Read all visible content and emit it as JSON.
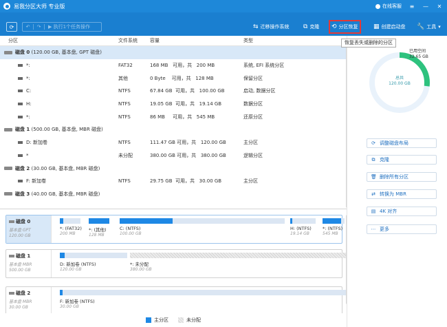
{
  "app": {
    "title": "易我分区大师 专业版",
    "online_service": "在线客服",
    "win_menu": "≡",
    "win_min": "—",
    "win_close": "✕"
  },
  "toolbar": {
    "refresh": "⟳",
    "undo": "↶",
    "redo": "↷",
    "pending_ops": "▶ 执行1个任务操作",
    "migrate_os": "迁移操作系统",
    "clone": "克隆",
    "partition_recovery": "分区恢复",
    "create_boot": "创建启动盘",
    "tools": "工具",
    "tooltip": "恢复丢失或删除的分区"
  },
  "table": {
    "headers": {
      "partition": "分区",
      "filesystem": "文件系统",
      "capacity": "容量",
      "type": "类型"
    },
    "rows": [
      {
        "kind": "disk",
        "name": "磁盘 0",
        "info": "(120.00 GB, 基本盘, GPT 磁盘)",
        "selected": true
      },
      {
        "kind": "part",
        "name": "*:",
        "fs": "FAT32",
        "cap": "168 MB   可用，共   200 MB",
        "type": "系统, EFI 系统分区"
      },
      {
        "kind": "part",
        "name": "*:",
        "fs": "其他",
        "cap": "0 Byte    可用，共   128 MB",
        "type": "保留分区"
      },
      {
        "kind": "part",
        "name": "C:",
        "fs": "NTFS",
        "cap": "67.84 GB  可用，共   100.00 GB",
        "type": "启动, 数据分区"
      },
      {
        "kind": "part",
        "name": "H:",
        "fs": "NTFS",
        "cap": "19.05 GB  可用，共   19.14 GB",
        "type": "数据分区"
      },
      {
        "kind": "part",
        "name": "*:",
        "fs": "NTFS",
        "cap": "86 MB     可用，共   545 MB",
        "type": "还原分区"
      },
      {
        "kind": "disk",
        "name": "磁盘 1",
        "info": "(500.00 GB, 基本盘, MBR 磁盘)"
      },
      {
        "kind": "part",
        "name": "D: 新加卷",
        "fs": "NTFS",
        "cap": "111.47 GB 可用，共   120.00 GB",
        "type": "主分区"
      },
      {
        "kind": "part",
        "name": "*",
        "fs": "未分配",
        "cap": "380.00 GB 可用，共   380.00 GB",
        "type": "逻辑分区"
      },
      {
        "kind": "disk",
        "name": "磁盘 2",
        "info": "(30.00 GB, 基本盘, MBR 磁盘)"
      },
      {
        "kind": "part",
        "name": "F: 新加卷",
        "fs": "NTFS",
        "cap": "29.75 GB  可用，共   30.00 GB",
        "type": "主分区"
      },
      {
        "kind": "disk",
        "name": "磁盘 3",
        "info": "(40.00 GB, 基本盘, MBR 磁盘)"
      }
    ]
  },
  "disks": [
    {
      "name": "磁盘 0",
      "sub": "基本盘 GPT",
      "size": "120.00 GB",
      "parts": [
        {
          "name": "*: (FAT32)",
          "size": "200 MB",
          "used": 0.16
        },
        {
          "name": "*: (其他)",
          "size": "128 MB",
          "used": 1.0
        },
        {
          "name": "C: (NTFS)",
          "size": "100.00 GB",
          "used": 0.32
        },
        {
          "name": "H: (NTFS)",
          "size": "19.14 GB",
          "used": 0.01
        },
        {
          "name": "*: (NTFS)",
          "size": "545 MB",
          "used": 0.84
        }
      ]
    },
    {
      "name": "磁盘 1",
      "sub": "基本盘 MBR",
      "size": "500.00 GB",
      "parts": [
        {
          "name": "D: 新加卷 (NTFS)",
          "size": "120.00 GB",
          "used": 0.07
        },
        {
          "name": "*: 未分配",
          "size": "380.00 GB",
          "used": 0
        }
      ]
    },
    {
      "name": "磁盘 2",
      "sub": "基本盘 MBR",
      "size": "30.00 GB",
      "parts": [
        {
          "name": "F: 新加卷 (NTFS)",
          "size": "30.00 GB",
          "used": 0.01
        }
      ]
    }
  ],
  "legend": {
    "primary": "主分区",
    "unallocated": "未分配"
  },
  "right_panel": {
    "used_label": "已用空间",
    "used_value": "32.65 GB",
    "total_label": "总共",
    "total_value": "120.00 GB",
    "used_fraction": 0.27,
    "ops": [
      {
        "icon": "adjust-layout-icon",
        "label": "调整磁盘布局"
      },
      {
        "icon": "clone-icon",
        "label": "克隆"
      },
      {
        "icon": "trash-icon",
        "label": "删除所有分区"
      },
      {
        "icon": "convert-icon",
        "label": "转换为 MBR"
      },
      {
        "icon": "align-icon",
        "label": "4K 对齐"
      },
      {
        "icon": "more-icon",
        "label": "更多"
      }
    ]
  },
  "colors": {
    "accent": "#1e88d9",
    "primary_part": "#1e88e5",
    "ring": "#2ec27e",
    "highlight": "#e53935"
  }
}
